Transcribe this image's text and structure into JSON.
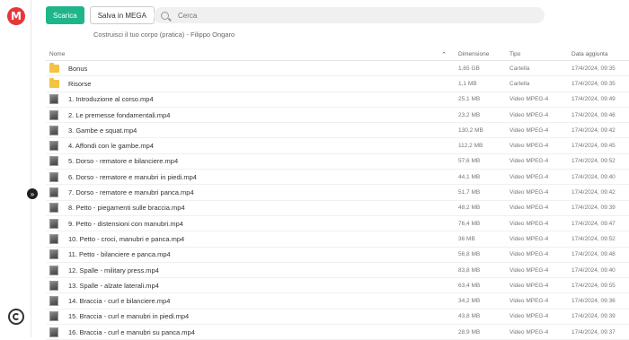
{
  "sidebar": {
    "logo_letter": "M"
  },
  "toolbar": {
    "download_label": "Scarica",
    "save_label": "Salva in MEGA"
  },
  "search": {
    "placeholder": "Cerca",
    "value": ""
  },
  "breadcrumb": "Costruisci il tuo corpo (pratica) - Filippo Ongaro",
  "table": {
    "columns": {
      "name": "Nome",
      "size": "Dimensione",
      "type": "Tipo",
      "date": "Data aggiunta"
    },
    "rows": [
      {
        "kind": "folder",
        "name": "Bonus",
        "size": "1,65 GB",
        "type": "Cartella",
        "date": "17/4/2024, 09:35"
      },
      {
        "kind": "folder",
        "name": "Risorse",
        "size": "1,1 MB",
        "type": "Cartella",
        "date": "17/4/2024, 09:35"
      },
      {
        "kind": "video",
        "name": "1. Introduzione al corso.mp4",
        "size": "25,1 MB",
        "type": "Video MPEG-4",
        "date": "17/4/2024, 09:49"
      },
      {
        "kind": "video",
        "name": "2. Le premesse fondamentali.mp4",
        "size": "23,2 MB",
        "type": "Video MPEG-4",
        "date": "17/4/2024, 09:46"
      },
      {
        "kind": "video",
        "name": "3. Gambe e squat.mp4",
        "size": "130,2 MB",
        "type": "Video MPEG-4",
        "date": "17/4/2024, 09:42"
      },
      {
        "kind": "video",
        "name": "4. Affondi con le gambe.mp4",
        "size": "112,2 MB",
        "type": "Video MPEG-4",
        "date": "17/4/2024, 09:45"
      },
      {
        "kind": "video",
        "name": "5. Dorso - rematore e bilanciere.mp4",
        "size": "57,6 MB",
        "type": "Video MPEG-4",
        "date": "17/4/2024, 09:52"
      },
      {
        "kind": "video",
        "name": "6. Dorso - rematore e manubri in piedi.mp4",
        "size": "44,1 MB",
        "type": "Video MPEG-4",
        "date": "17/4/2024, 09:40"
      },
      {
        "kind": "video",
        "name": "7. Dorso - rematore e manubri panca.mp4",
        "size": "51,7 MB",
        "type": "Video MPEG-4",
        "date": "17/4/2024, 09:42"
      },
      {
        "kind": "video",
        "name": "8. Petto - piegamenti sulle braccia.mp4",
        "size": "48,2 MB",
        "type": "Video MPEG-4",
        "date": "17/4/2024, 09:39"
      },
      {
        "kind": "video",
        "name": "9. Petto - distensioni con manubri.mp4",
        "size": "76,4 MB",
        "type": "Video MPEG-4",
        "date": "17/4/2024, 09:47"
      },
      {
        "kind": "video",
        "name": "10. Petto - croci, manubri e panca.mp4",
        "size": "36 MB",
        "type": "Video MPEG-4",
        "date": "17/4/2024, 09:52"
      },
      {
        "kind": "video",
        "name": "11. Petto - bilanciere e panca.mp4",
        "size": "56,8 MB",
        "type": "Video MPEG-4",
        "date": "17/4/2024, 09:48"
      },
      {
        "kind": "video",
        "name": "12. Spalle - military press.mp4",
        "size": "83,8 MB",
        "type": "Video MPEG-4",
        "date": "17/4/2024, 09:40"
      },
      {
        "kind": "video",
        "name": "13. Spalle - alzate laterali.mp4",
        "size": "63,4 MB",
        "type": "Video MPEG-4",
        "date": "17/4/2024, 09:55"
      },
      {
        "kind": "video",
        "name": "14. Braccia - curl e bilanciere.mp4",
        "size": "34,2 MB",
        "type": "Video MPEG-4",
        "date": "17/4/2024, 09:36"
      },
      {
        "kind": "video",
        "name": "15. Braccia - curl e manubri in piedi.mp4",
        "size": "43,8 MB",
        "type": "Video MPEG-4",
        "date": "17/4/2024, 09:39"
      },
      {
        "kind": "video",
        "name": "16. Braccia - curl e manubri su panca.mp4",
        "size": "28,9 MB",
        "type": "Video MPEG-4",
        "date": "17/4/2024, 09:37"
      }
    ]
  },
  "colors": {
    "accent": "#1fb58a",
    "logo": "#e5383b",
    "folder": "#f5c242"
  }
}
